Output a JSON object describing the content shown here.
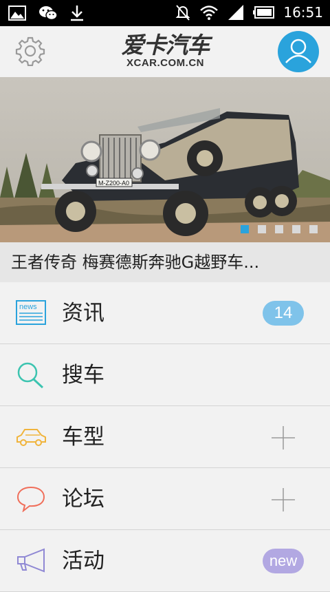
{
  "status_bar": {
    "time": "16:51",
    "icons": [
      "gallery-icon",
      "wechat-icon",
      "download-icon",
      "mute-icon",
      "wifi-icon",
      "signal-icon",
      "battery-icon"
    ]
  },
  "header": {
    "logo_cn": "爱卡汽车",
    "logo_en": "XCAR.COM.CN",
    "accent_color": "#2aa3dc"
  },
  "banner": {
    "image_alt": "vintage black and cream Mercedes-Benz convertible",
    "plate": "M-Z200-A0",
    "caption": "王者传奇 梅赛德斯奔驰G越野车...",
    "page_count": 5,
    "active_page": 1
  },
  "menu": {
    "items": [
      {
        "label": "资讯",
        "icon": "news-icon",
        "badge": "14"
      },
      {
        "label": "搜车",
        "icon": "search-icon"
      },
      {
        "label": "车型",
        "icon": "car-icon"
      },
      {
        "label": "论坛",
        "icon": "chat-bubble-icon"
      },
      {
        "label": "活动",
        "icon": "megaphone-icon",
        "badge": "new"
      }
    ]
  }
}
